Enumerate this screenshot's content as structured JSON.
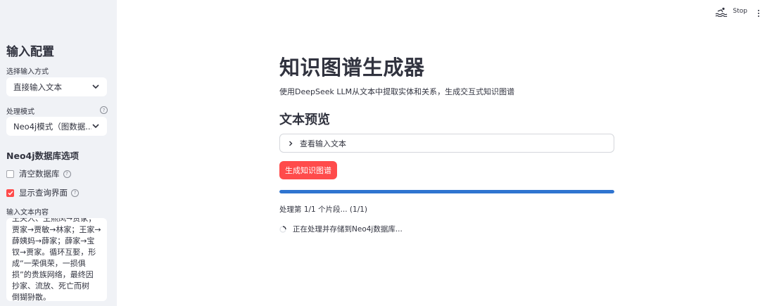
{
  "header": {
    "stop_label": "Stop",
    "stop_icon": "running-swimmer-icon",
    "menu_icon": "more-vertical-icon"
  },
  "sidebar": {
    "title": "输入配置",
    "input_method": {
      "label": "选择输入方式",
      "value": "直接输入文本"
    },
    "mode": {
      "label": "处理模式",
      "value": "Neo4j模式（图数据..."
    },
    "neo4j_section_title": "Neo4j数据库选项",
    "options": [
      {
        "label": "清空数据库",
        "checked": false
      },
      {
        "label": "显示查询界面",
        "checked": true
      }
    ],
    "text_input": {
      "label": "输入文本内容",
      "value": "王夫人、王熙凤→贾家；\n贾家→贾敏→林家；王家→\n薛姨妈→薛家；薛家→宝\n钗→贾家。循环互娶，形\n成“一荣俱荣，一损俱\n损”的贵族网络，最终因\n抄家、流放、死亡而树\n倒猢狲散。"
    }
  },
  "main": {
    "title": "知识图谱生成器",
    "description": "使用DeepSeek LLM从文本中提取实体和关系，生成交互式知识图谱",
    "preview_heading": "文本预览",
    "expander_label": "查看输入文本",
    "generate_button": "生成知识图谱",
    "progress_value": 1.0,
    "progress_text": "处理第 1/1 个片段... (1/1)",
    "status_text": "正在处理并存储到Neo4j数据库..."
  },
  "colors": {
    "accent": "#ff4b4b",
    "progress": "#2f74d0",
    "sidebar_bg": "#f0f2f6"
  }
}
